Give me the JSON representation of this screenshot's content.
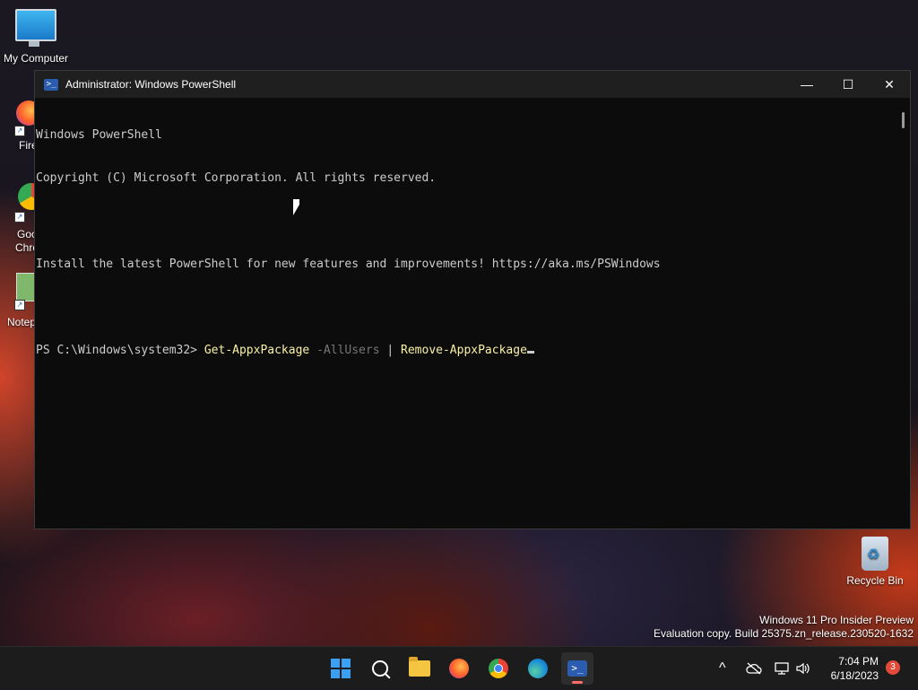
{
  "desktop": {
    "my_computer_label": "My Computer",
    "firefox_label": "Fire",
    "chrome_label_1": "Goo",
    "chrome_label_2": "Chro",
    "notepad_label": "Notep",
    "recycle_bin_label": "Recycle Bin",
    "watermark_line1": "Windows 11 Pro Insider Preview",
    "watermark_line2": "Evaluation copy. Build 25375.zn_release.230520-1632"
  },
  "window": {
    "title": "Administrator: Windows PowerShell",
    "minimize_glyph": "—",
    "maximize_glyph": "☐",
    "close_glyph": "✕",
    "console": {
      "line1": "Windows PowerShell",
      "line2": "Copyright (C) Microsoft Corporation. All rights reserved.",
      "line3": "Install the latest PowerShell for new features and improvements! https://aka.ms/PSWindows",
      "prompt": "PS C:\\Windows\\system32> ",
      "cmd1": "Get-AppxPackage",
      "param1": " -AllUsers",
      "pipe": " | ",
      "cmd2": "Remove-AppxPackage"
    }
  },
  "taskbar": {
    "apps": [
      "start",
      "search",
      "file-explorer",
      "firefox",
      "chrome",
      "edge",
      "powershell"
    ],
    "active_app": "powershell",
    "tray_chevron": "^",
    "time": "7:04 PM",
    "date": "6/18/2023",
    "notification_count": "3",
    "accent_color": "#3aa0f3"
  }
}
